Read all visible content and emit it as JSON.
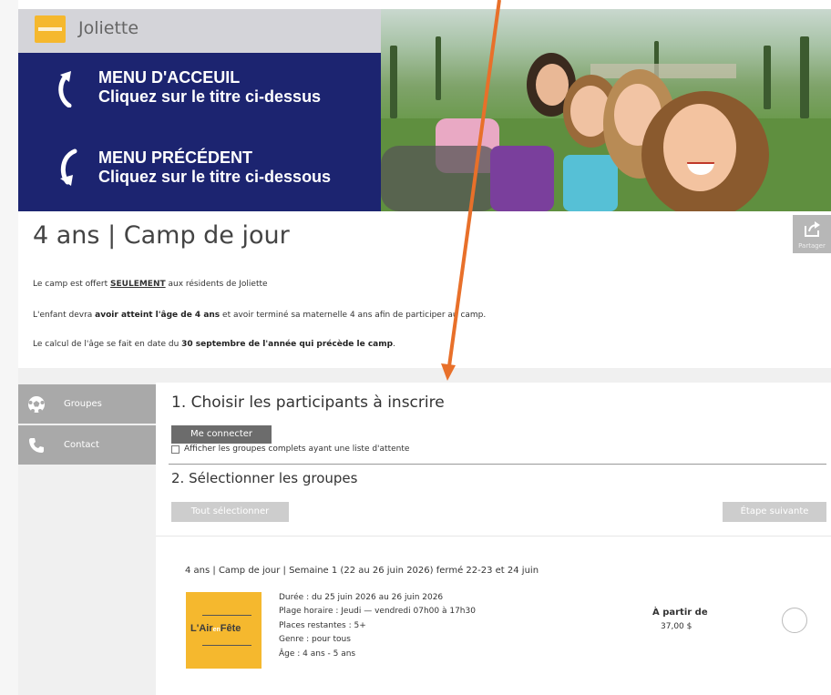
{
  "header": {
    "site_name": "Joliette",
    "logo_icon": "city-logo-icon"
  },
  "banner": {
    "nav_home_line1": "MENU D'ACCEUIL",
    "nav_home_line2": "Cliquez sur le titre ci-dessus",
    "nav_prev_line1": "MENU PRÉCÉDENT",
    "nav_prev_line2": "Cliquez sur le titre ci-dessous"
  },
  "page": {
    "title": "4 ans | Camp de jour",
    "share_label": "Partager"
  },
  "description": {
    "line1_pre": "Le camp est offert ",
    "line1_emph": "SEULEMENT",
    "line1_post": " aux résidents de Joliette",
    "line2_pre": "L'enfant devra ",
    "line2_bold": "avoir atteint l'âge de 4 ans",
    "line2_post": " et avoir terminé sa maternelle 4 ans afin de participer au camp.",
    "line3_pre": "Le calcul de l'âge se fait en date du ",
    "line3_bold": "30 septembre de l'année qui précède le camp",
    "line3_post": "."
  },
  "sidebar": {
    "items": [
      {
        "label": "Groupes",
        "icon": "soccer-ball-icon"
      },
      {
        "label": "Contact",
        "icon": "phone-icon"
      }
    ]
  },
  "step1": {
    "heading": "1. Choisir les participants à inscrire",
    "connect_button": "Me connecter",
    "checkbox_label": "Afficher les groupes complets ayant une liste d'attente"
  },
  "step2": {
    "heading": "2. Sélectionner les groupes",
    "select_all_button": "Tout sélectionner",
    "next_step_button": "Étape suivante"
  },
  "group": {
    "title": "4 ans | Camp de jour | Semaine 1 (22 au 26 juin 2026) fermé 22-23 et 24 juin",
    "logo_text_main": "L'Air",
    "logo_text_small": "en",
    "logo_text_end": "Fête",
    "duration": "Durée : du 25 juin 2026 au 26 juin 2026",
    "schedule": "Plage horaire : Jeudi — vendredi 07h00 à 17h30",
    "places": "Places restantes : 5+",
    "gender": "Genre : pour tous",
    "age": "Âge : 4 ans - 5 ans",
    "price_from": "À partir de",
    "price": "37,00 $"
  },
  "colors": {
    "banner_navy": "#1c2470",
    "logo_yellow": "#f5b82e",
    "annotation_arrow": "#e8702a",
    "sidebar_grey": "#a9a9a9"
  }
}
